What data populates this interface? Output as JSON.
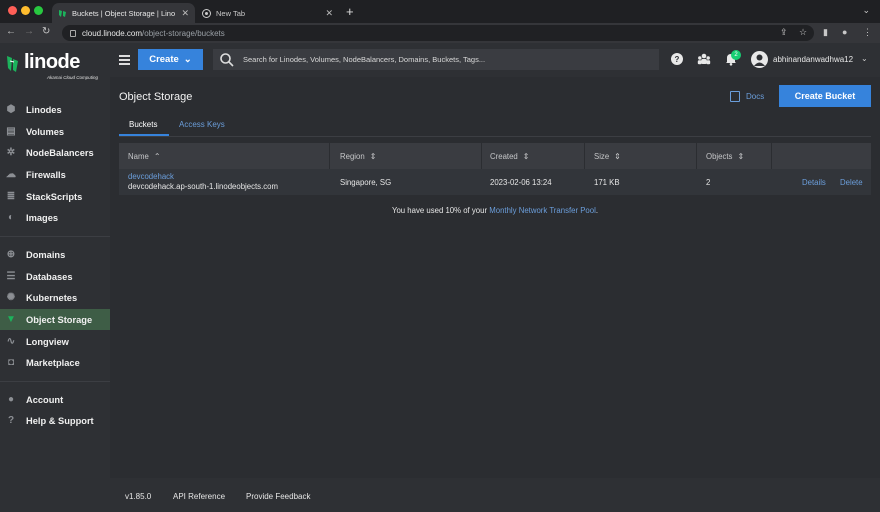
{
  "browser": {
    "tabs": [
      {
        "title": "Buckets | Object Storage | Lino",
        "active": true
      },
      {
        "title": "New Tab",
        "active": false
      }
    ],
    "url_host": "cloud.linode.com",
    "url_path": "/object-storage/buckets"
  },
  "logo": {
    "word": "linode",
    "sub": "Akamai Cloud Computing"
  },
  "sidebar": {
    "items": [
      {
        "label": "Linodes",
        "icon": "server-icon"
      },
      {
        "label": "Volumes",
        "icon": "volume-icon"
      },
      {
        "label": "NodeBalancers",
        "icon": "nodebalancer-icon"
      },
      {
        "label": "Firewalls",
        "icon": "firewall-icon"
      },
      {
        "label": "StackScripts",
        "icon": "stackscript-icon"
      },
      {
        "label": "Images",
        "icon": "image-icon"
      },
      {
        "label": "Domains",
        "icon": "globe-icon"
      },
      {
        "label": "Databases",
        "icon": "database-icon"
      },
      {
        "label": "Kubernetes",
        "icon": "kubernetes-icon"
      },
      {
        "label": "Object Storage",
        "icon": "bucket-icon",
        "active": true
      },
      {
        "label": "Longview",
        "icon": "pulse-icon"
      },
      {
        "label": "Marketplace",
        "icon": "bag-icon"
      },
      {
        "label": "Account",
        "icon": "user-icon"
      },
      {
        "label": "Help & Support",
        "icon": "help-icon"
      }
    ]
  },
  "topbar": {
    "create_label": "Create",
    "search_placeholder": "Search for Linodes, Volumes, NodeBalancers, Domains, Buckets, Tags...",
    "notification_count": "2",
    "username": "abhinandanwadhwa12"
  },
  "page": {
    "title": "Object Storage",
    "docs_label": "Docs",
    "create_bucket_label": "Create Bucket",
    "tabs": [
      "Buckets",
      "Access Keys"
    ]
  },
  "table": {
    "headers": [
      "Name",
      "Region",
      "Created",
      "Size",
      "Objects"
    ],
    "rows": [
      {
        "name": "devcodehack",
        "hostname": "devcodehack.ap-south-1.linodeobjects.com",
        "region": "Singapore, SG",
        "created": "2023-02-06 13:24",
        "size": "171 KB",
        "objects": "2",
        "actions": [
          "Details",
          "Delete"
        ]
      }
    ]
  },
  "transfer_note": {
    "prefix": "You have used 10% of your ",
    "link": "Monthly Network Transfer Pool",
    "suffix": "."
  },
  "footer": {
    "version": "v1.85.0",
    "api_reference": "API Reference",
    "feedback": "Provide Feedback"
  },
  "colors": {
    "accent": "#3683dc",
    "active_nav": "#3e5d46",
    "link": "#6b9edb",
    "badge": "#17cf73"
  }
}
